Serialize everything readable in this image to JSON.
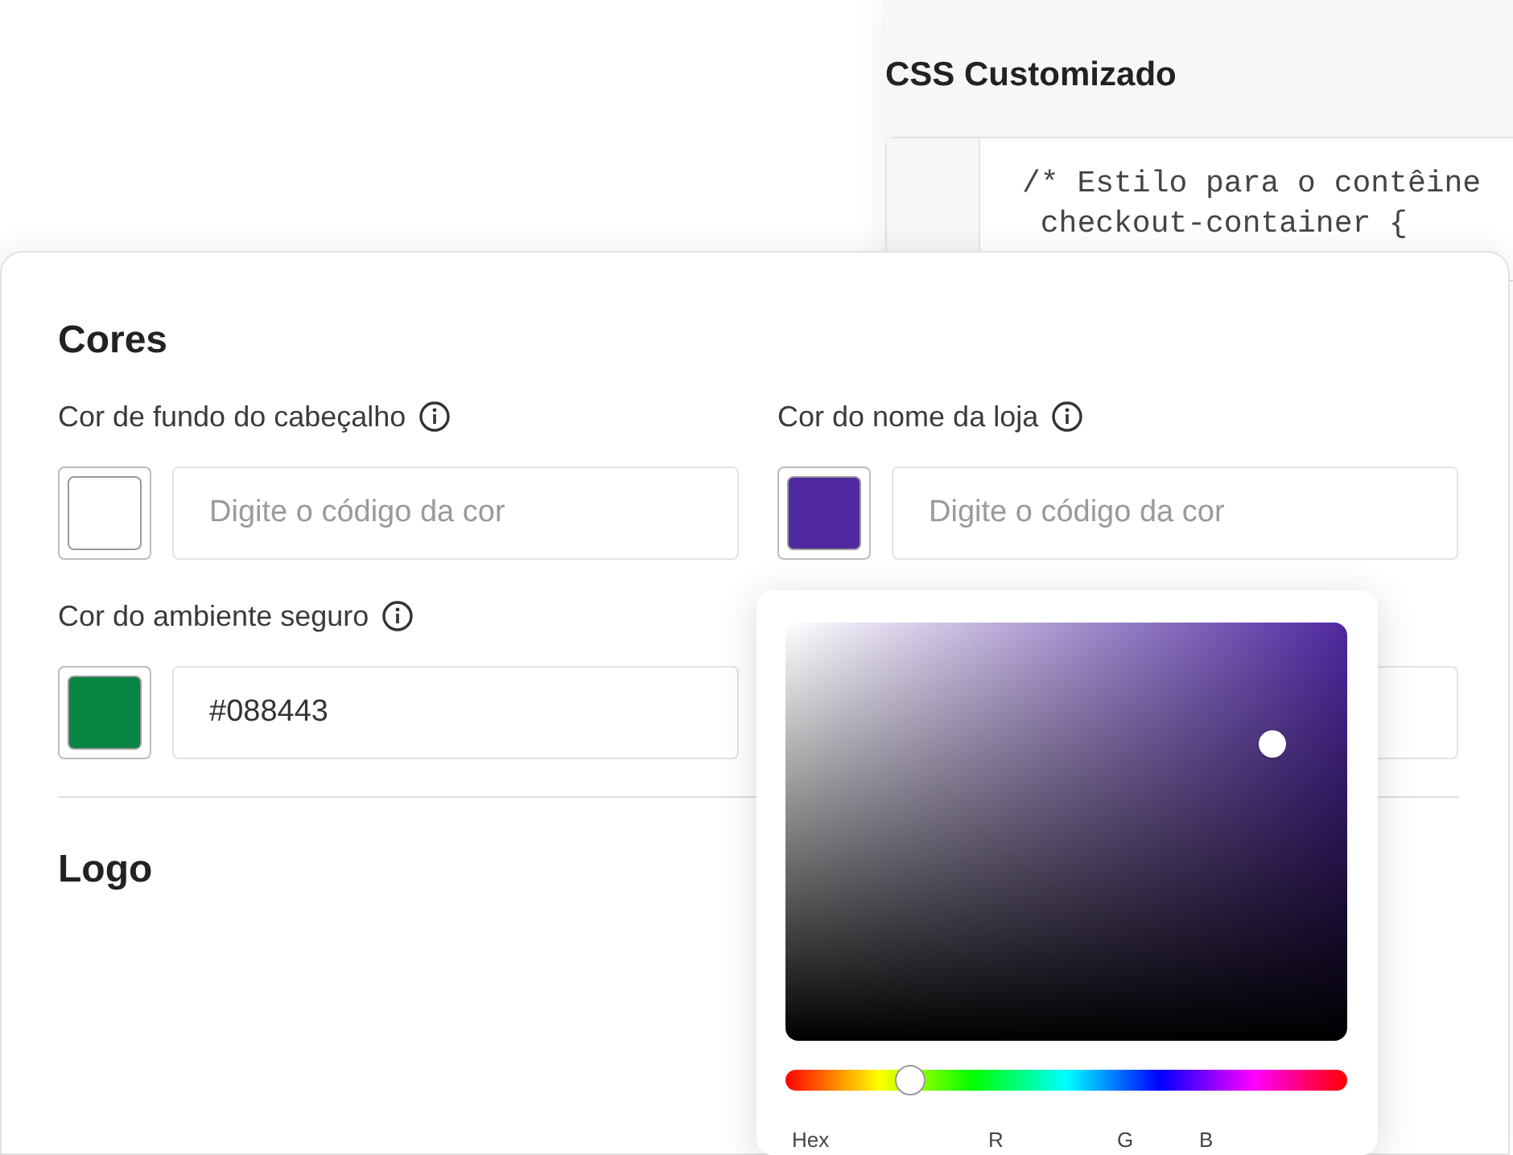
{
  "css_panel": {
    "title": "CSS Customizado",
    "code_lines": [
      "/* Estilo para o contêine",
      " checkout-container {"
    ]
  },
  "colors_panel": {
    "title": "Cores",
    "fields": [
      {
        "label": "Cor de fundo do cabeçalho",
        "color": "#ffffff",
        "placeholder": "Digite o código da cor"
      },
      {
        "label": "Cor do nome da loja",
        "color": "#5028a0",
        "placeholder": "Digite o código da cor",
        "picker_open": true
      },
      {
        "label": "Cor do ambiente seguro",
        "color": "#088443",
        "value": "#088443"
      }
    ],
    "next_section": "Logo"
  },
  "color_picker": {
    "hue": {
      "level": 0.22
    },
    "channel_labels": [
      "Hex",
      "R",
      "G",
      "B"
    ]
  }
}
